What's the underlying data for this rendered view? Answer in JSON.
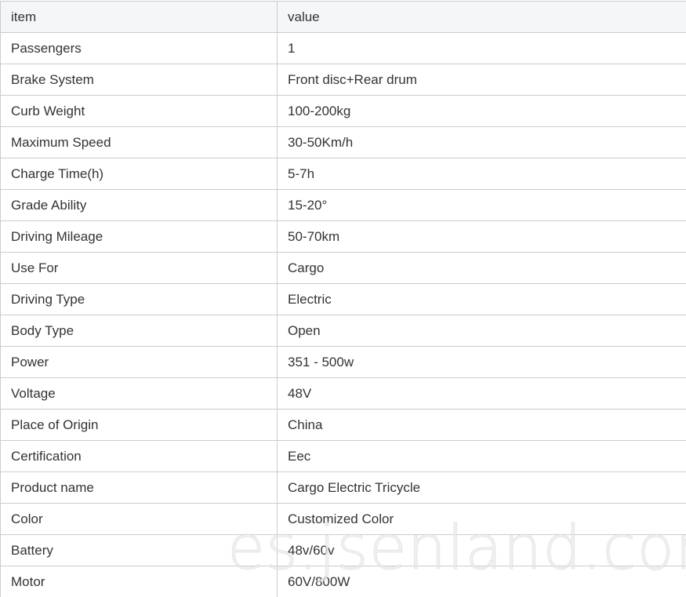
{
  "table": {
    "headers": {
      "item": "item",
      "value": "value"
    },
    "rows": [
      {
        "item": "Passengers",
        "value": "1"
      },
      {
        "item": "Brake System",
        "value": "Front disc+Rear drum"
      },
      {
        "item": "Curb Weight",
        "value": "100-200kg"
      },
      {
        "item": "Maximum Speed",
        "value": "30-50Km/h"
      },
      {
        "item": "Charge Time(h)",
        "value": "5-7h"
      },
      {
        "item": "Grade Ability",
        "value": "15-20°"
      },
      {
        "item": "Driving Mileage",
        "value": "50-70km"
      },
      {
        "item": "Use For",
        "value": "Cargo"
      },
      {
        "item": "Driving Type",
        "value": "Electric"
      },
      {
        "item": "Body Type",
        "value": "Open"
      },
      {
        "item": "Power",
        "value": "351 - 500w"
      },
      {
        "item": "Voltage",
        "value": "48V"
      },
      {
        "item": "Place of Origin",
        "value": "China"
      },
      {
        "item": "Certification",
        "value": "Eec"
      },
      {
        "item": "Product name",
        "value": "Cargo Electric Tricycle"
      },
      {
        "item": "Color",
        "value": "Customized Color"
      },
      {
        "item": "Battery",
        "value": "48v/60v"
      },
      {
        "item": "Motor",
        "value": "60V/800W"
      }
    ]
  },
  "watermark": {
    "text": "es.jsenland.com"
  }
}
